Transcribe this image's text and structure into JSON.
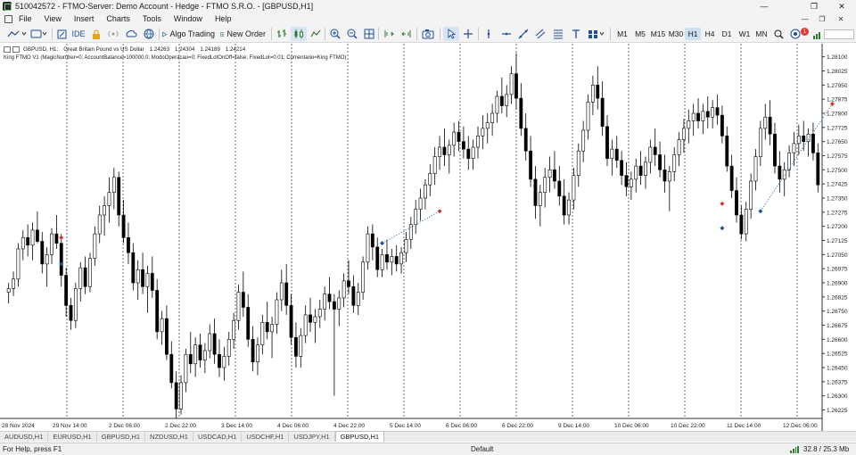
{
  "window": {
    "title": "510042572 - FTMO-Server: Demo Account - Hedge - FTMO S.R.O. - [GBPUSD,H1]",
    "minimize": "—",
    "restore": "❐",
    "close": "✕"
  },
  "menu": {
    "items": [
      "File",
      "View",
      "Insert",
      "Charts",
      "Tools",
      "Window",
      "Help"
    ],
    "mdi_minimize": "—",
    "mdi_restore": "❐",
    "mdi_close": "✕"
  },
  "toolbar": {
    "ide_label": "IDE",
    "algo_trading_label": "Algo Trading",
    "new_order_label": "New Order",
    "timeframes": [
      "M1",
      "M5",
      "M15",
      "M30",
      "H1",
      "H4",
      "D1",
      "W1",
      "MN"
    ],
    "active_timeframe": "H1",
    "notifications_count": "1",
    "icons": [
      "line-chart-icon",
      "template-icon",
      "lock-icon",
      "signal-icon",
      "cloud-icon",
      "globe-icon",
      "play-icon",
      "new-order-icon",
      "bar-chart-icon",
      "candlestick-icon",
      "line-icon",
      "zoom-in-icon",
      "zoom-out-icon",
      "grid-icon",
      "autoscroll-icon",
      "chart-shift-icon",
      "screenshot-icon",
      "cursor-icon",
      "crosshair-icon",
      "vertical-line-icon",
      "horizontal-line-icon",
      "trendline-icon",
      "fibonacci-icon",
      "equidistant-channel-icon",
      "text-icon",
      "shapes-icon",
      "search-icon",
      "notifications-icon"
    ]
  },
  "chart": {
    "symbol": "GBPUSD, H1:",
    "description": "Great Britain Pound vs US Dollar",
    "ohlc": [
      "1.24263",
      "1.24304",
      "1.24189",
      "1.24214"
    ],
    "expert_line": "King FTMO V1 (MagicNumber=0; AccountBalance=100000.0; ModoOperacao=0; FixedLotOnOff=false; FixedLot=0.01; Comentario=King FTMO)",
    "colors": {
      "bull": "#000000",
      "bear": "#000000",
      "grid": "#000000",
      "buy_marker": "#1f4fa0",
      "sell_marker": "#d9342b"
    }
  },
  "price_axis": [
    "1.28100",
    "1.28025",
    "1.27950",
    "1.27875",
    "1.27800",
    "1.27725",
    "1.27650",
    "1.27575",
    "1.27500",
    "1.27425",
    "1.27350",
    "1.27275",
    "1.27200",
    "1.27125",
    "1.27050",
    "1.26975",
    "1.26900",
    "1.26825",
    "1.26750",
    "1.26675",
    "1.26600",
    "1.26525",
    "1.26450",
    "1.26375",
    "1.26300",
    "1.26225"
  ],
  "time_axis": [
    "28 Nov 2024",
    "29 Nov 14:00",
    "2 Dec 06:00",
    "2 Dec 22:00",
    "3 Dec 14:00",
    "4 Dec 06:00",
    "4 Dec 22:00",
    "5 Dec 14:00",
    "6 Dec 06:00",
    "6 Dec 22:00",
    "9 Dec 14:00",
    "10 Dec 06:00",
    "10 Dec 22:00",
    "11 Dec 14:00",
    "12 Dec 06:00"
  ],
  "chart_data": {
    "type": "candlestick",
    "symbol": "GBPUSD",
    "timeframe": "H1",
    "ylim": [
      1.2618,
      1.2816
    ],
    "candles": [
      [
        1.2685,
        1.269,
        1.2679,
        1.2687
      ],
      [
        1.2687,
        1.2696,
        1.2683,
        1.2692
      ],
      [
        1.2692,
        1.2711,
        1.2688,
        1.2708
      ],
      [
        1.2708,
        1.2718,
        1.2702,
        1.2714
      ],
      [
        1.2714,
        1.2721,
        1.2704,
        1.271
      ],
      [
        1.271,
        1.2722,
        1.2702,
        1.2718
      ],
      [
        1.2718,
        1.2728,
        1.2711,
        1.2712
      ],
      [
        1.2712,
        1.2717,
        1.2695,
        1.27
      ],
      [
        1.27,
        1.2709,
        1.2688,
        1.2705
      ],
      [
        1.2705,
        1.2719,
        1.27,
        1.2716
      ],
      [
        1.2716,
        1.2726,
        1.2708,
        1.2711
      ],
      [
        1.2711,
        1.2716,
        1.2688,
        1.2694
      ],
      [
        1.2694,
        1.2698,
        1.2672,
        1.2678
      ],
      [
        1.2678,
        1.2682,
        1.2665,
        1.267
      ],
      [
        1.267,
        1.269,
        1.2666,
        1.2687
      ],
      [
        1.2687,
        1.2701,
        1.268,
        1.2698
      ],
      [
        1.2698,
        1.2704,
        1.2684,
        1.2688
      ],
      [
        1.2688,
        1.2706,
        1.2685,
        1.2703
      ],
      [
        1.2703,
        1.272,
        1.2699,
        1.2716
      ],
      [
        1.2716,
        1.2731,
        1.2711,
        1.2726
      ],
      [
        1.2726,
        1.2736,
        1.2715,
        1.2731
      ],
      [
        1.2731,
        1.2746,
        1.2722,
        1.2738
      ],
      [
        1.2738,
        1.2751,
        1.2729,
        1.2746
      ],
      [
        1.2746,
        1.2749,
        1.272,
        1.2726
      ],
      [
        1.2726,
        1.2734,
        1.2711,
        1.2714
      ],
      [
        1.2714,
        1.2722,
        1.27,
        1.2706
      ],
      [
        1.2706,
        1.2711,
        1.2686,
        1.269
      ],
      [
        1.269,
        1.2702,
        1.2681,
        1.2697
      ],
      [
        1.2697,
        1.2706,
        1.2684,
        1.2688
      ],
      [
        1.2688,
        1.2699,
        1.2674,
        1.2695
      ],
      [
        1.2695,
        1.2704,
        1.2682,
        1.2686
      ],
      [
        1.2686,
        1.2692,
        1.266,
        1.2664
      ],
      [
        1.2664,
        1.2675,
        1.2657,
        1.2671
      ],
      [
        1.2671,
        1.2678,
        1.2649,
        1.2652
      ],
      [
        1.2652,
        1.2659,
        1.2634,
        1.2637
      ],
      [
        1.2637,
        1.2643,
        1.2618,
        1.2623
      ],
      [
        1.2623,
        1.2641,
        1.262,
        1.2637
      ],
      [
        1.2637,
        1.2655,
        1.2632,
        1.2652
      ],
      [
        1.2652,
        1.2664,
        1.2642,
        1.2647
      ],
      [
        1.2647,
        1.2661,
        1.264,
        1.2657
      ],
      [
        1.2657,
        1.2663,
        1.2645,
        1.2649
      ],
      [
        1.2649,
        1.2658,
        1.2642,
        1.2654
      ],
      [
        1.2654,
        1.2668,
        1.265,
        1.2663
      ],
      [
        1.2663,
        1.2671,
        1.2647,
        1.2652
      ],
      [
        1.2652,
        1.266,
        1.264,
        1.2645
      ],
      [
        1.2645,
        1.2656,
        1.2638,
        1.2651
      ],
      [
        1.2651,
        1.2664,
        1.2646,
        1.266
      ],
      [
        1.266,
        1.2674,
        1.2655,
        1.267
      ],
      [
        1.267,
        1.2689,
        1.2665,
        1.2685
      ],
      [
        1.2685,
        1.2696,
        1.2672,
        1.2677
      ],
      [
        1.2677,
        1.2684,
        1.2656,
        1.266
      ],
      [
        1.266,
        1.2667,
        1.2643,
        1.2648
      ],
      [
        1.2648,
        1.2661,
        1.2641,
        1.2657
      ],
      [
        1.2657,
        1.2673,
        1.2652,
        1.2669
      ],
      [
        1.2669,
        1.268,
        1.266,
        1.2664
      ],
      [
        1.2664,
        1.2672,
        1.265,
        1.2668
      ],
      [
        1.2668,
        1.2685,
        1.2663,
        1.2681
      ],
      [
        1.2681,
        1.2697,
        1.2675,
        1.269
      ],
      [
        1.269,
        1.27,
        1.2673,
        1.2678
      ],
      [
        1.2678,
        1.2684,
        1.2657,
        1.2661
      ],
      [
        1.2661,
        1.2669,
        1.2645,
        1.2651
      ],
      [
        1.2651,
        1.2666,
        1.2645,
        1.2662
      ],
      [
        1.2662,
        1.2678,
        1.2658,
        1.2673
      ],
      [
        1.2673,
        1.2682,
        1.2664,
        1.2669
      ],
      [
        1.2669,
        1.2676,
        1.2658,
        1.2672
      ],
      [
        1.2672,
        1.2681,
        1.2666,
        1.2676
      ],
      [
        1.2676,
        1.2688,
        1.267,
        1.2684
      ],
      [
        1.2684,
        1.2693,
        1.2676,
        1.268
      ],
      [
        1.268,
        1.2684,
        1.263,
        1.2676
      ],
      [
        1.2676,
        1.2686,
        1.2667,
        1.2682
      ],
      [
        1.2682,
        1.2695,
        1.2677,
        1.2691
      ],
      [
        1.2691,
        1.2702,
        1.2684,
        1.2688
      ],
      [
        1.2688,
        1.2694,
        1.2674,
        1.2678
      ],
      [
        1.2678,
        1.269,
        1.2673,
        1.2685
      ],
      [
        1.2685,
        1.2704,
        1.2681,
        1.2701
      ],
      [
        1.2701,
        1.272,
        1.2697,
        1.2716
      ],
      [
        1.2716,
        1.2721,
        1.2702,
        1.2709
      ],
      [
        1.2709,
        1.2714,
        1.2693,
        1.2697
      ],
      [
        1.2697,
        1.2708,
        1.2693,
        1.2705
      ],
      [
        1.2705,
        1.2713,
        1.2697,
        1.2701
      ],
      [
        1.2701,
        1.2708,
        1.2694,
        1.2704
      ],
      [
        1.2704,
        1.271,
        1.2696,
        1.27
      ],
      [
        1.27,
        1.2709,
        1.2695,
        1.2706
      ],
      [
        1.2706,
        1.2717,
        1.2701,
        1.2713
      ],
      [
        1.2713,
        1.2725,
        1.2708,
        1.2721
      ],
      [
        1.2721,
        1.2734,
        1.2716,
        1.2729
      ],
      [
        1.2729,
        1.274,
        1.2723,
        1.2735
      ],
      [
        1.2735,
        1.2745,
        1.2729,
        1.2742
      ],
      [
        1.2742,
        1.2753,
        1.2736,
        1.2748
      ],
      [
        1.2748,
        1.2762,
        1.2742,
        1.2757
      ],
      [
        1.2757,
        1.2768,
        1.275,
        1.2762
      ],
      [
        1.2762,
        1.2772,
        1.2752,
        1.2758
      ],
      [
        1.2758,
        1.2766,
        1.2748,
        1.2763
      ],
      [
        1.2763,
        1.2775,
        1.2757,
        1.277
      ],
      [
        1.277,
        1.2776,
        1.276,
        1.2765
      ],
      [
        1.2765,
        1.2773,
        1.2756,
        1.2761
      ],
      [
        1.2761,
        1.2768,
        1.275,
        1.2756
      ],
      [
        1.2756,
        1.2766,
        1.275,
        1.2762
      ],
      [
        1.2762,
        1.2773,
        1.2756,
        1.2768
      ],
      [
        1.2768,
        1.2779,
        1.2761,
        1.2772
      ],
      [
        1.2772,
        1.278,
        1.2764,
        1.2775
      ],
      [
        1.2775,
        1.2785,
        1.2768,
        1.278
      ],
      [
        1.278,
        1.2792,
        1.2775,
        1.2789
      ],
      [
        1.2789,
        1.2799,
        1.278,
        1.2784
      ],
      [
        1.2784,
        1.2795,
        1.2778,
        1.279
      ],
      [
        1.279,
        1.2805,
        1.2785,
        1.2801
      ],
      [
        1.2801,
        1.2812,
        1.2782,
        1.2788
      ],
      [
        1.2788,
        1.2796,
        1.2768,
        1.2772
      ],
      [
        1.2772,
        1.278,
        1.2755,
        1.276
      ],
      [
        1.276,
        1.2768,
        1.2741,
        1.2745
      ],
      [
        1.2745,
        1.2752,
        1.2724,
        1.2731
      ],
      [
        1.2731,
        1.2742,
        1.272,
        1.2738
      ],
      [
        1.2738,
        1.2751,
        1.273,
        1.2746
      ],
      [
        1.2746,
        1.2757,
        1.2738,
        1.275
      ],
      [
        1.275,
        1.276,
        1.274,
        1.2744
      ],
      [
        1.2744,
        1.2752,
        1.2731,
        1.2736
      ],
      [
        1.2736,
        1.2745,
        1.2721,
        1.2726
      ],
      [
        1.2726,
        1.2738,
        1.2721,
        1.2734
      ],
      [
        1.2734,
        1.2751,
        1.2729,
        1.2747
      ],
      [
        1.2747,
        1.2764,
        1.2741,
        1.276
      ],
      [
        1.276,
        1.2776,
        1.2754,
        1.2771
      ],
      [
        1.2771,
        1.279,
        1.2766,
        1.2786
      ],
      [
        1.2786,
        1.28,
        1.2779,
        1.2795
      ],
      [
        1.2795,
        1.2805,
        1.2782,
        1.2788
      ],
      [
        1.2788,
        1.2797,
        1.2768,
        1.2773
      ],
      [
        1.2773,
        1.2779,
        1.2752,
        1.2756
      ],
      [
        1.2756,
        1.2766,
        1.2747,
        1.2761
      ],
      [
        1.2761,
        1.2768,
        1.2751,
        1.2755
      ],
      [
        1.2755,
        1.276,
        1.2742,
        1.2747
      ],
      [
        1.2747,
        1.2754,
        1.2736,
        1.2741
      ],
      [
        1.2741,
        1.2749,
        1.2734,
        1.2745
      ],
      [
        1.2745,
        1.2756,
        1.2738,
        1.2752
      ],
      [
        1.2752,
        1.276,
        1.2742,
        1.2747
      ],
      [
        1.2747,
        1.2757,
        1.274,
        1.2754
      ],
      [
        1.2754,
        1.2766,
        1.2748,
        1.2762
      ],
      [
        1.2762,
        1.2772,
        1.2752,
        1.2758
      ],
      [
        1.2758,
        1.2765,
        1.2746,
        1.275
      ],
      [
        1.275,
        1.2758,
        1.2738,
        1.2744
      ],
      [
        1.2744,
        1.2752,
        1.2728,
        1.2749
      ],
      [
        1.2749,
        1.2762,
        1.2744,
        1.2758
      ],
      [
        1.2758,
        1.277,
        1.2752,
        1.2766
      ],
      [
        1.2766,
        1.2777,
        1.2759,
        1.2772
      ],
      [
        1.2772,
        1.2782,
        1.2764,
        1.2776
      ],
      [
        1.2776,
        1.2785,
        1.2768,
        1.278
      ],
      [
        1.278,
        1.2788,
        1.2772,
        1.2776
      ],
      [
        1.2776,
        1.2785,
        1.2769,
        1.2781
      ],
      [
        1.2781,
        1.2789,
        1.2772,
        1.2778
      ],
      [
        1.2778,
        1.2787,
        1.2772,
        1.2783
      ],
      [
        1.2783,
        1.279,
        1.2774,
        1.2779
      ],
      [
        1.2779,
        1.2784,
        1.2764,
        1.2768
      ],
      [
        1.2768,
        1.2773,
        1.2749,
        1.2752
      ],
      [
        1.2752,
        1.2758,
        1.2735,
        1.2739
      ],
      [
        1.2739,
        1.2746,
        1.2722,
        1.2726
      ],
      [
        1.2726,
        1.2731,
        1.2713,
        1.2716
      ],
      [
        1.2716,
        1.2733,
        1.2712,
        1.2729
      ],
      [
        1.2729,
        1.2748,
        1.2724,
        1.2744
      ],
      [
        1.2744,
        1.2761,
        1.2739,
        1.2757
      ],
      [
        1.2757,
        1.2776,
        1.2752,
        1.2772
      ],
      [
        1.2772,
        1.2785,
        1.2766,
        1.2778
      ],
      [
        1.2778,
        1.2787,
        1.2763,
        1.2769
      ],
      [
        1.2769,
        1.2775,
        1.2748,
        1.2752
      ],
      [
        1.2752,
        1.276,
        1.2738,
        1.2745
      ],
      [
        1.2745,
        1.2754,
        1.2736,
        1.275
      ],
      [
        1.275,
        1.2763,
        1.2746,
        1.2759
      ],
      [
        1.2759,
        1.277,
        1.2752,
        1.2764
      ],
      [
        1.2764,
        1.2774,
        1.2758,
        1.2768
      ],
      [
        1.2768,
        1.2776,
        1.276,
        1.2765
      ],
      [
        1.2765,
        1.2772,
        1.2757,
        1.2769
      ],
      [
        1.2769,
        1.2775,
        1.2755,
        1.2759
      ],
      [
        1.2759,
        1.2764,
        1.2738,
        1.2742
      ]
    ],
    "trades": [
      {
        "buy_index": 11,
        "buy_price": 1.27,
        "sell_index": 11,
        "sell_price": 1.2714
      },
      {
        "buy_index": 78,
        "buy_price": 1.2711,
        "sell_index": 90,
        "sell_price": 1.2728
      },
      {
        "buy_index": 149,
        "buy_price": 1.2719,
        "sell_index": 149,
        "sell_price": 1.2732
      },
      {
        "buy_index": 157,
        "buy_price": 1.2728,
        "sell_index": 172,
        "sell_price": 1.2785
      }
    ]
  },
  "tabs": {
    "items": [
      "AUDUSD,H1",
      "EURUSD,H1",
      "GBPUSD,H1",
      "NZDUSD,H1",
      "USDCAD,H1",
      "USDCHF,H1",
      "USDJPY,H1",
      "GBPUSD,H1"
    ],
    "active_index": 7
  },
  "status": {
    "help": "For Help, press F1",
    "profile": "Default",
    "traffic": "32.8 / 25.3 Mb"
  }
}
